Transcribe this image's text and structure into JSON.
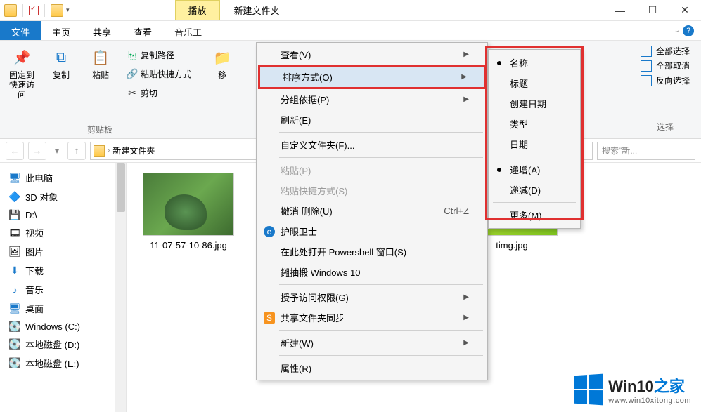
{
  "titlebar": {
    "play_tab": "播放",
    "title": "新建文件夹"
  },
  "tabs": {
    "file": "文件",
    "home": "主页",
    "share": "共享",
    "view": "查看",
    "music": "音乐工"
  },
  "ribbon": {
    "pin": "固定到快速访问",
    "copy": "复制",
    "paste": "粘贴",
    "copy_path": "复制路径",
    "paste_shortcut": "粘贴快捷方式",
    "cut": "剪切",
    "clipboard_group": "剪贴板",
    "move": "移",
    "select_all": "全部选择",
    "select_none": "全部取消",
    "select_invert": "反向选择",
    "select_group": "选择"
  },
  "breadcrumb": {
    "current": "新建文件夹"
  },
  "search": {
    "placeholder": "搜索\"新..."
  },
  "sidebar": {
    "items": [
      {
        "icon": "🖥",
        "label": "此电脑",
        "color": "#1979ca"
      },
      {
        "icon": "▫",
        "label": "3D 对象",
        "color": "#3ac"
      },
      {
        "icon": "▤",
        "label": "D:\\",
        "color": "#888"
      },
      {
        "icon": "▦",
        "label": "视频",
        "color": "#b44"
      },
      {
        "icon": "▭",
        "label": "图片",
        "color": "#3a8"
      },
      {
        "icon": "⬇",
        "label": "下载",
        "color": "#1979ca"
      },
      {
        "icon": "♪",
        "label": "音乐",
        "color": "#1979ca"
      },
      {
        "icon": "▬",
        "label": "桌面",
        "color": "#1979ca"
      },
      {
        "icon": "⊞",
        "label": "Windows (C:)",
        "color": "#888"
      },
      {
        "icon": "▭",
        "label": "本地磁盘 (D:)",
        "color": "#888"
      },
      {
        "icon": "▭",
        "label": "本地磁盘 (E:)",
        "color": "#888"
      }
    ]
  },
  "files": [
    {
      "name": "11-07-57-10-86.jpg"
    },
    {
      "name": "timg.jpg"
    }
  ],
  "ctx": {
    "view": "查看(V)",
    "sort": "排序方式(O)",
    "group": "分组依据(P)",
    "refresh": "刷新(E)",
    "customize": "自定义文件夹(F)...",
    "paste": "粘贴(P)",
    "paste_shortcut": "粘贴快捷方式(S)",
    "undo": "撤消 删除(U)",
    "undo_key": "Ctrl+Z",
    "eye": "护眼卫士",
    "powershell": "在此处打开 Powershell 窗口(S)",
    "win10": "鎺抽椴 Windows 10",
    "grant": "授予访问权限(G)",
    "sync": "共享文件夹同步",
    "new": "新建(W)",
    "props": "属性(R)"
  },
  "submenu": {
    "name": "名称",
    "title": "标题",
    "created": "创建日期",
    "type": "类型",
    "date": "日期",
    "asc": "递增(A)",
    "desc": "递减(D)",
    "more": "更多(M)..."
  },
  "watermark": {
    "brand_a": "Win10",
    "brand_b": "之家",
    "url": "www.win10xitong.com"
  }
}
